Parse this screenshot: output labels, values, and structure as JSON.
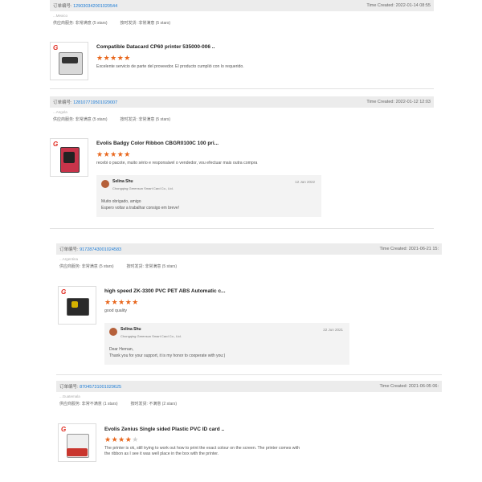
{
  "labels": {
    "order_no": "订单编号:",
    "time_created": "Time Created:",
    "supplier_service": "供应商服务:",
    "shipping_speed": "按时发货:"
  },
  "orders": [
    {
      "order_no": "129030342001020544",
      "time_created": "2022-01-14 08:55",
      "buyer": "...Mexico",
      "supplier_rating": "非常满意",
      "supplier_stars": "(5 stars)",
      "shipping_rating": "非常满意",
      "shipping_stars": "(5 stars)",
      "product_title": "Compatible Datacard CP60 printer 535000-006 ..",
      "stars": 5,
      "comment": "Excelente servicio de parte del proveedor. El producto cumplió con lo requerido."
    },
    {
      "order_no": "128107719501029007",
      "time_created": "2022-01-12 12:03",
      "buyer": "...Angola",
      "supplier_rating": "非常满意",
      "supplier_stars": "(5 stars)",
      "shipping_rating": "非常满意",
      "shipping_stars": "(5 stars)",
      "product_title": "Evolis Badgy Color Ribbon CBGR0100C 100 pri...",
      "stars": 5,
      "comment": "recebi o pacote, muito sério e responsável o vendedor, vou efectuar mais outra compra",
      "reply": {
        "name": "Selina Shu",
        "company": "Chongqing Greensun Smart Card Co., Ltd.",
        "date": "12 Jan 2022",
        "lines": [
          "Muito obrigado, amigo",
          "Espero voltar a trabalhar consigo em breve!"
        ]
      }
    },
    {
      "order_no": "91728743001024583",
      "time_created": "2021-06-21 15:",
      "buyer": "...Argentina",
      "supplier_rating": "非常满意",
      "supplier_stars": "(5 stars)",
      "shipping_rating": "非常满意",
      "shipping_stars": "(5 stars)",
      "product_title": "high speed ZK-3300 PVC PET ABS Automatic c...",
      "stars": 5,
      "comment": "good quality",
      "reply": {
        "name": "Selina Shu",
        "company": "Chongqing Greensun Smart Card Co., Ltd.",
        "date": "22 Jun 2021",
        "lines": [
          "Dear Hernan,",
          "Thank you for your support, it is my honor to cooperate with you:)"
        ]
      }
    },
    {
      "order_no": "87045731001029625",
      "time_created": "2021-06-05 06:",
      "buyer": "...Guatemala",
      "supplier_rating": "非常不满意",
      "supplier_stars": "(1 stars)",
      "shipping_rating": "不满意",
      "shipping_stars": "(2 stars)",
      "product_title": "Evolis Zenius Single sided Plastic PVC ID card ..",
      "stars": 4,
      "comment_lines": [
        "The printer is ok, still trying to work out how to print the exact colour on the screen. The printer comes with",
        "the ribbon as I see it was well place in the box with the printer."
      ]
    }
  ],
  "colors": {
    "order_link": "#1a7bd6",
    "star": "#e8661c",
    "header_bg": "#ececec",
    "reply_bg": "#f3f3f3"
  },
  "icons": {
    "brand_logo": "brand-logo-icon",
    "star": "star-icon",
    "avatar": "avatar-icon"
  }
}
